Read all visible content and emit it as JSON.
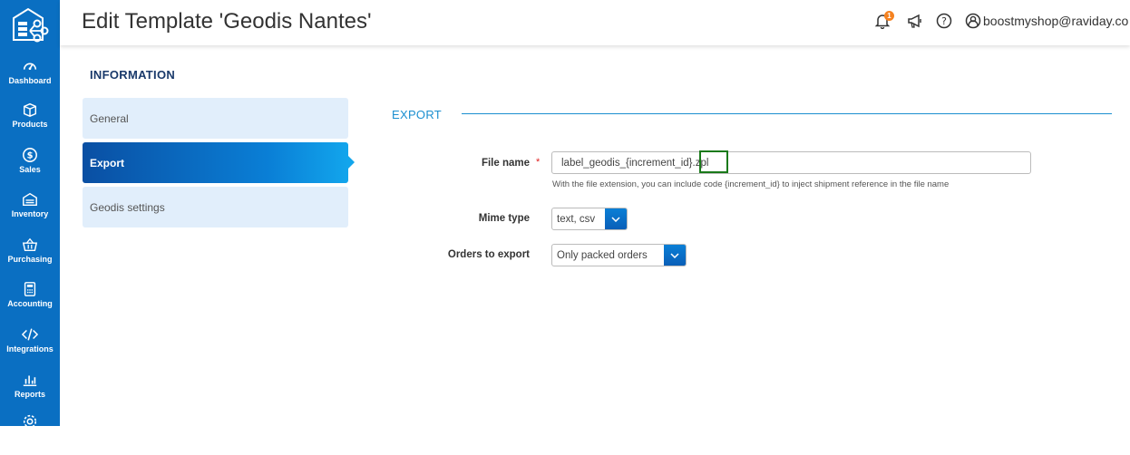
{
  "header": {
    "title": "Edit Template 'Geodis Nantes'",
    "notifications_count": "1",
    "user_email": "boostmyshop@raviday.co"
  },
  "sidebar": {
    "items": [
      {
        "label": "Dashboard",
        "icon": "dashboard-icon"
      },
      {
        "label": "Products",
        "icon": "box-icon"
      },
      {
        "label": "Sales",
        "icon": "dollar-icon"
      },
      {
        "label": "Inventory",
        "icon": "warehouse-icon"
      },
      {
        "label": "Purchasing",
        "icon": "basket-icon"
      },
      {
        "label": "Accounting",
        "icon": "calculator-icon"
      },
      {
        "label": "Integrations",
        "icon": "code-icon"
      },
      {
        "label": "Reports",
        "icon": "bar-chart-icon"
      }
    ]
  },
  "info": {
    "heading": "INFORMATION",
    "tabs": [
      {
        "label": "General",
        "active": false
      },
      {
        "label": "Export",
        "active": true
      },
      {
        "label": "Geodis settings",
        "active": false
      }
    ]
  },
  "export": {
    "heading": "EXPORT",
    "file_name": {
      "label": "File name",
      "required_mark": "*",
      "value": "label_geodis_{increment_id}.zpl",
      "hint": "With the file extension, you can include code {increment_id} to inject shipment reference in the file name"
    },
    "mime_type": {
      "label": "Mime type",
      "value": "text, csv"
    },
    "orders_to_export": {
      "label": "Orders to export",
      "value": "Only packed orders"
    }
  },
  "colors": {
    "sidebar": "#0a6fc2",
    "accent": "#1b8fd0",
    "badge": "#f58220",
    "highlight": "#1a7a1a"
  }
}
